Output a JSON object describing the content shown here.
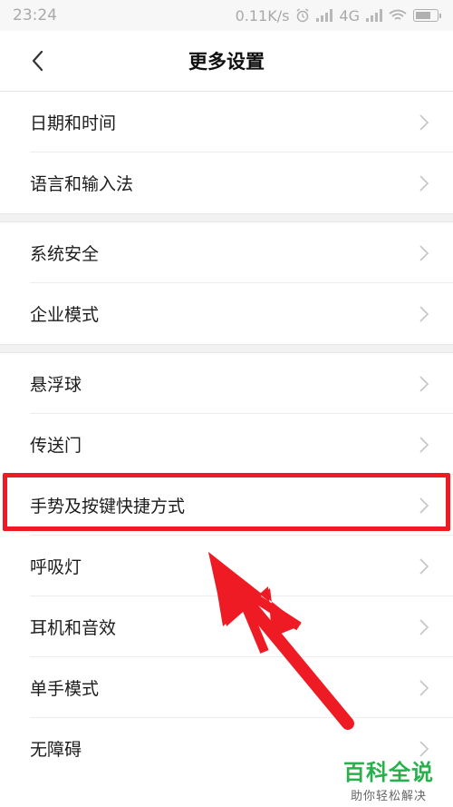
{
  "status_bar": {
    "time": "23:24",
    "speed": "0.11K/s",
    "network": "4G"
  },
  "header": {
    "title": "更多设置"
  },
  "groups": [
    {
      "items": [
        {
          "label": "日期和时间"
        },
        {
          "label": "语言和输入法"
        }
      ]
    },
    {
      "items": [
        {
          "label": "系统安全"
        },
        {
          "label": "企业模式"
        }
      ]
    },
    {
      "items": [
        {
          "label": "悬浮球"
        },
        {
          "label": "传送门"
        },
        {
          "label": "手势及按键快捷方式"
        },
        {
          "label": "呼吸灯"
        },
        {
          "label": "耳机和音效"
        },
        {
          "label": "单手模式"
        },
        {
          "label": "无障碍"
        }
      ]
    }
  ],
  "annotation": {
    "highlight_color": "#ee1a24",
    "arrow_color": "#ee1a24"
  },
  "watermark": {
    "title": "百科全说",
    "subtitle": "助你轻松解决",
    "color": "#27b14c"
  }
}
